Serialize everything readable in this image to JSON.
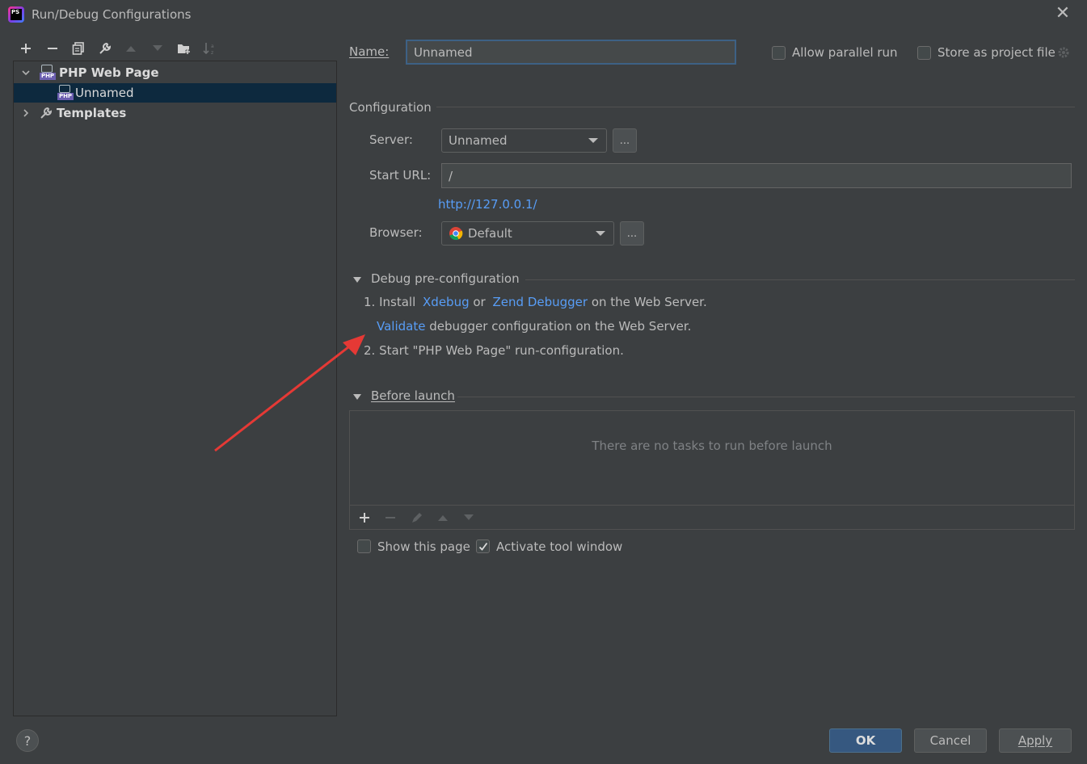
{
  "window": {
    "title": "Run/Debug Configurations",
    "app_icon_text": "PS"
  },
  "toolbar": {
    "icons": [
      "add-icon",
      "remove-icon",
      "copy-icon",
      "wrench-icon",
      "move-up-icon",
      "move-down-icon",
      "new-folder-icon",
      "sort-icon"
    ]
  },
  "tree": {
    "items": [
      {
        "label": "PHP Web Page",
        "expanded": true
      },
      {
        "label": "Unnamed",
        "selected": true
      },
      {
        "label": "Templates",
        "expanded": false
      }
    ]
  },
  "name_field": {
    "label": "Name:",
    "value": "Unnamed"
  },
  "options": {
    "allow_parallel": {
      "label": "Allow parallel run",
      "checked": false
    },
    "store_as_project": {
      "label": "Store as project file",
      "checked": false
    }
  },
  "configuration": {
    "section_title": "Configuration",
    "server_label": "Server:",
    "server_value": "Unnamed",
    "server_more": "...",
    "start_url_label": "Start URL:",
    "start_url_value": "/",
    "resolved_url": "http://127.0.0.1/",
    "browser_label": "Browser:",
    "browser_value": "Default",
    "browser_more": "..."
  },
  "debug_preconfig": {
    "title": "Debug pre-configuration",
    "step1_prefix": "1. Install",
    "xdebug_link": "Xdebug",
    "or_text": "or",
    "zend_link": "Zend Debugger",
    "step1_suffix": "on the Web Server.",
    "validate_link": "Validate",
    "validate_suffix": "debugger configuration on the Web Server.",
    "step2": "2. Start \"PHP Web Page\" run-configuration."
  },
  "before_launch": {
    "title": "Before launch",
    "empty_text": "There are no tasks to run before launch"
  },
  "bottom_options": {
    "show_page": {
      "label": "Show this page",
      "checked": false
    },
    "activate_tool": {
      "label": "Activate tool window",
      "checked": true
    }
  },
  "buttons": {
    "help": "?",
    "ok": "OK",
    "cancel": "Cancel",
    "apply": "Apply"
  },
  "colors": {
    "background": "#3c3f41",
    "link": "#589df6",
    "selection": "#0d293e",
    "ok_button": "#365880",
    "annotation_arrow": "#e53935"
  }
}
